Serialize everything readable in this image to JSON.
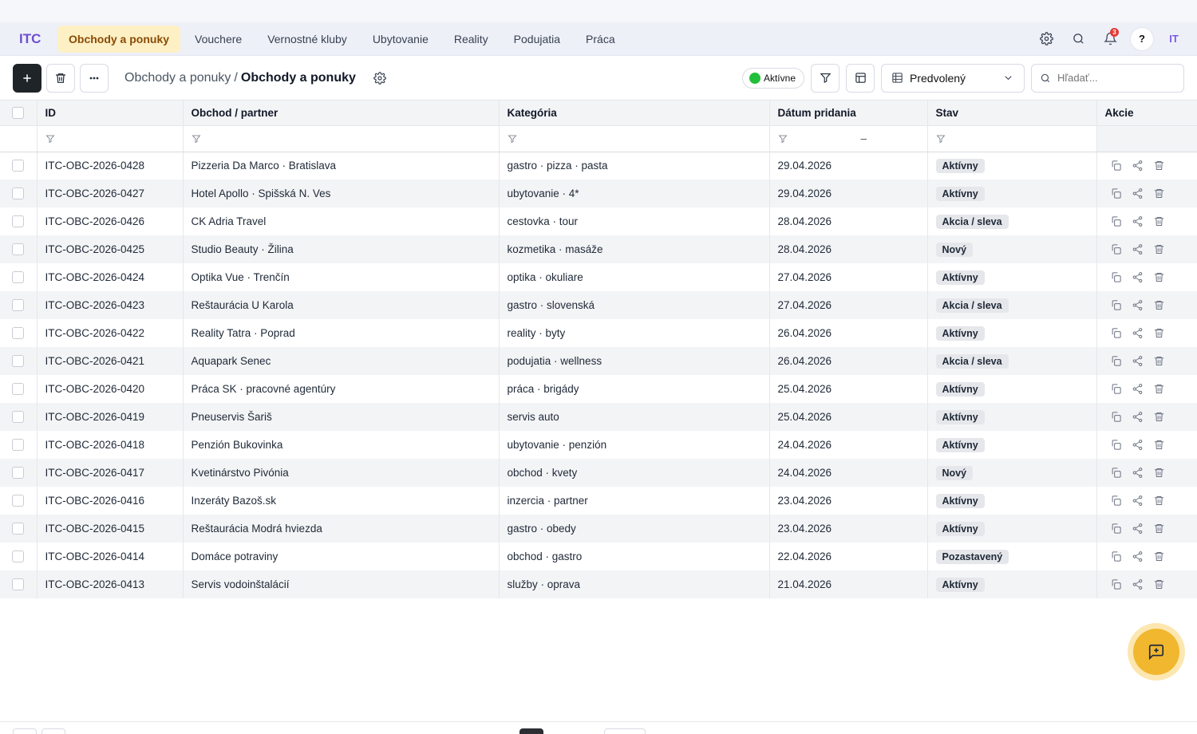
{
  "app": {
    "logo": "ITC"
  },
  "nav": {
    "tabs": [
      {
        "label": "Obchody a ponuky",
        "active": true
      },
      {
        "label": "Vouchere"
      },
      {
        "label": "Vernostné kluby"
      },
      {
        "label": "Ubytovanie"
      },
      {
        "label": "Reality"
      },
      {
        "label": "Podujatia"
      },
      {
        "label": "Práca"
      }
    ],
    "notifications_count": "3",
    "help_label": "?",
    "avatar_initials": "IT"
  },
  "toolbar": {
    "breadcrumb": {
      "parent": "Obchody a ponuky",
      "separator": "/",
      "current": "Obchody a ponuky"
    },
    "status_label": "Aktívne",
    "view_label": "Predvolený",
    "search_placeholder": "Hľadať..."
  },
  "table": {
    "columns": [
      "ID",
      "Obchod / partner",
      "Kategória",
      "Dátum pridania",
      "Stav",
      "Akcie"
    ],
    "date_range_separator": "–",
    "rows": [
      {
        "id": "ITC-OBC-2026-0428",
        "partner": "Pizzeria Da Marco · Bratislava",
        "category": "gastro · pizza · pasta",
        "date": "29.04.2026",
        "status": "Aktívny"
      },
      {
        "id": "ITC-OBC-2026-0427",
        "partner": "Hotel Apollo · Spišská N. Ves",
        "category": "ubytovanie · 4*",
        "date": "29.04.2026",
        "status": "Aktívny"
      },
      {
        "id": "ITC-OBC-2026-0426",
        "partner": "CK Adria Travel",
        "category": "cestovka · tour",
        "date": "28.04.2026",
        "status": "Akcia / sleva"
      },
      {
        "id": "ITC-OBC-2026-0425",
        "partner": "Studio Beauty · Žilina",
        "category": "kozmetika · masáže",
        "date": "28.04.2026",
        "status": "Nový"
      },
      {
        "id": "ITC-OBC-2026-0424",
        "partner": "Optika Vue · Trenčín",
        "category": "optika · okuliare",
        "date": "27.04.2026",
        "status": "Aktívny"
      },
      {
        "id": "ITC-OBC-2026-0423",
        "partner": "Reštaurácia U Karola",
        "category": "gastro · slovenská",
        "date": "27.04.2026",
        "status": "Akcia / sleva"
      },
      {
        "id": "ITC-OBC-2026-0422",
        "partner": "Reality Tatra · Poprad",
        "category": "reality · byty",
        "date": "26.04.2026",
        "status": "Aktívny"
      },
      {
        "id": "ITC-OBC-2026-0421",
        "partner": "Aquapark Senec",
        "category": "podujatia · wellness",
        "date": "26.04.2026",
        "status": "Akcia / sleva"
      },
      {
        "id": "ITC-OBC-2026-0420",
        "partner": "Práca SK · pracovné agentúry",
        "category": "práca · brigády",
        "date": "25.04.2026",
        "status": "Aktívny"
      },
      {
        "id": "ITC-OBC-2026-0419",
        "partner": "Pneuservis Šariš",
        "category": "servis auto",
        "date": "25.04.2026",
        "status": "Aktívny"
      },
      {
        "id": "ITC-OBC-2026-0418",
        "partner": "Penzión Bukovinka",
        "category": "ubytovanie · penzión",
        "date": "24.04.2026",
        "status": "Aktívny"
      },
      {
        "id": "ITC-OBC-2026-0417",
        "partner": "Kvetinárstvo Pivónia",
        "category": "obchod · kvety",
        "date": "24.04.2026",
        "status": "Nový"
      },
      {
        "id": "ITC-OBC-2026-0416",
        "partner": "Inzeráty Bazoš.sk",
        "category": "inzercia · partner",
        "date": "23.04.2026",
        "status": "Aktívny"
      },
      {
        "id": "ITC-OBC-2026-0415",
        "partner": "Reštaurácia Modrá hviezda",
        "category": "gastro · obedy",
        "date": "23.04.2026",
        "status": "Aktívny"
      },
      {
        "id": "ITC-OBC-2026-0414",
        "partner": "Domáce potraviny",
        "category": "obchod · gastro",
        "date": "22.04.2026",
        "status": "Pozastavený"
      },
      {
        "id": "ITC-OBC-2026-0413",
        "partner": "Servis vodoinštalácií",
        "category": "služby · oprava",
        "date": "21.04.2026",
        "status": "Aktívny"
      }
    ]
  },
  "colors": {
    "accent": "#6d4fd1",
    "active_tab_bg": "#fdf0c4",
    "fab": "#f0b72f",
    "status_dot": "#1fbf3a"
  }
}
